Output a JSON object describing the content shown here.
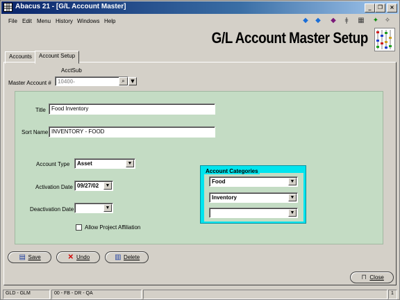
{
  "window": {
    "title": "Abacus 21 - [G/L Account Master]"
  },
  "menu": [
    "File",
    "Edit",
    "Menu",
    "History",
    "Windows",
    "Help"
  ],
  "header": {
    "title": "G/L Account Master Setup"
  },
  "tabs": [
    "Accounts",
    "Account Setup"
  ],
  "form": {
    "acct_sub_label": "AcctSub",
    "master_account_label": "Master Account #",
    "master_account_value": "10400-",
    "title_label": "Title",
    "title_value": "Food Inventory",
    "sort_name_label": "Sort Name",
    "sort_name_value": "INVENTORY - FOOD",
    "account_type_label": "Account Type",
    "account_type_value": "Asset",
    "activation_date_label": "Activation Date",
    "activation_date_value": "09/27/02",
    "deactivation_date_label": "Deactivation Date",
    "deactivation_date_value": "",
    "allow_project_label": "Allow Project Affiliation",
    "allow_project_checked": false
  },
  "categories": {
    "title": "Account Categories",
    "items": [
      "Food",
      "Inventory",
      ""
    ]
  },
  "buttons": {
    "save": "Save",
    "undo": "Undo",
    "delete": "Delete",
    "close": "Close"
  },
  "status": {
    "module": "GLD - GLM",
    "codes": "00 - FB - DR - QA",
    "page": "1"
  },
  "colors": {
    "form_bg": "#c4dcc4",
    "categories_border": "#00e5ee",
    "titlebar": "#0a246a"
  }
}
